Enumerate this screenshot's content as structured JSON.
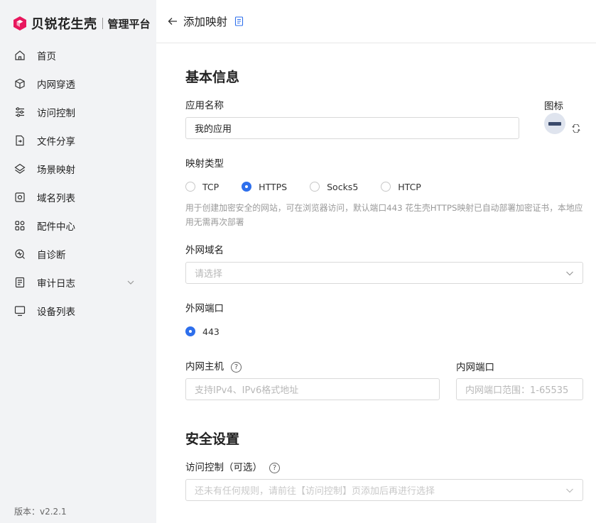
{
  "brand": {
    "name": "贝锐花生壳",
    "sub": "管理平台"
  },
  "sidebar": {
    "items": [
      {
        "label": "首页",
        "icon": "home-icon"
      },
      {
        "label": "内网穿透",
        "icon": "cube-icon"
      },
      {
        "label": "访问控制",
        "icon": "sliders-icon"
      },
      {
        "label": "文件分享",
        "icon": "file-share-icon"
      },
      {
        "label": "场景映射",
        "icon": "layers-icon"
      },
      {
        "label": "域名列表",
        "icon": "domain-icon"
      },
      {
        "label": "配件中心",
        "icon": "grid-icon"
      },
      {
        "label": "自诊断",
        "icon": "diagnose-icon"
      },
      {
        "label": "审计日志",
        "icon": "log-icon"
      },
      {
        "label": "设备列表",
        "icon": "monitor-icon"
      }
    ],
    "version": "版本：v2.2.1"
  },
  "header": {
    "title": "添加映射"
  },
  "basic": {
    "section_title": "基本信息",
    "app_name_label": "应用名称",
    "app_name_value": "我的应用",
    "icon_label": "图标",
    "mapping_type_label": "映射类型",
    "mapping_types": [
      {
        "label": "TCP",
        "selected": false
      },
      {
        "label": "HTTPS",
        "selected": true
      },
      {
        "label": "Socks5",
        "selected": false
      },
      {
        "label": "HTCP",
        "selected": false
      }
    ],
    "hint": "用于创建加密安全的网站，可在浏览器访问，默认端口443 花生壳HTTPS映射已自动部署加密证书，本地应用无需再次部署",
    "domain_label": "外网域名",
    "domain_placeholder": "请选择",
    "port_label": "外网端口",
    "port_value": "443",
    "host_label": "内网主机",
    "host_placeholder": "支持IPv4、IPv6格式地址",
    "inner_port_label": "内网端口",
    "inner_port_placeholder": "内网端口范围：1-65535"
  },
  "security": {
    "section_title": "安全设置",
    "access_label": "访问控制（可选）",
    "access_placeholder": "还未有任何规则，请前往【访问控制】页添加后再进行选择"
  },
  "colors": {
    "accent": "#2e6fec",
    "brand": "#e8175d",
    "sidebar_bg": "#f2f3f5"
  }
}
